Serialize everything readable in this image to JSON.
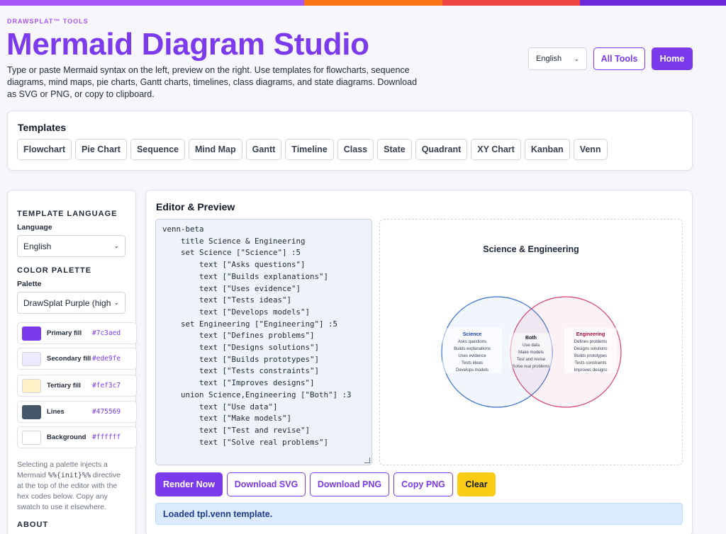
{
  "colors": {
    "topbar": [
      "#a855f7",
      "#f97316",
      "#ef4444",
      "#6d28d9"
    ],
    "primary": "#7c3aed",
    "clear_button": "#facc15"
  },
  "header": {
    "brand": "DRAWSPLAT™ TOOLS",
    "title": "Mermaid Diagram Studio",
    "description": "Type or paste Mermaid syntax on the left, preview on the right. Use templates for flowcharts, sequence diagrams, mind maps, pie charts, Gantt charts, timelines, class diagrams, and state diagrams. Download as SVG or PNG, or copy to clipboard.",
    "language_selected": "English",
    "all_tools_label": "All Tools",
    "home_label": "Home"
  },
  "templates": {
    "title": "Templates",
    "items": [
      "Flowchart",
      "Pie Chart",
      "Sequence",
      "Mind Map",
      "Gantt",
      "Timeline",
      "Class",
      "State",
      "Quadrant",
      "XY Chart",
      "Kanban",
      "Venn"
    ]
  },
  "sidebar": {
    "template_language_heading": "TEMPLATE LANGUAGE",
    "language_label": "Language",
    "language_value": "English",
    "color_palette_heading": "COLOR PALETTE",
    "palette_label": "Palette",
    "palette_value": "DrawSplat Purple (high c",
    "swatches": [
      {
        "name": "Primary fill",
        "hex": "#7c3aed"
      },
      {
        "name": "Secondary fill",
        "hex": "#ede9fe"
      },
      {
        "name": "Tertiary fill",
        "hex": "#fef3c7"
      },
      {
        "name": "Lines",
        "hex": "#475569"
      },
      {
        "name": "Background",
        "hex": "#ffffff"
      }
    ],
    "note_pre": "Selecting a palette injects a Mermaid",
    "note_code": "%%{init}%%",
    "note_post": "directive at the top of the editor with the hex codes below. Copy any swatch to use it elsewhere.",
    "about_heading": "ABOUT"
  },
  "editor": {
    "title": "Editor & Preview",
    "lines": [
      "venn-beta",
      "    title Science & Engineering",
      "    set Science [\"Science\"] :5",
      "        text [\"Asks questions\"]",
      "        text [\"Builds explanations\"]",
      "        text [\"Uses evidence\"]",
      "        text [\"Tests ideas\"]",
      "        text [\"Develops models\"]",
      "    set Engineering [\"Engineering\"] :5",
      "        text [\"Defines problems\"]",
      "        text [\"Designs solutions\"]",
      "        text [\"Builds prototypes\"]",
      "        text [\"Tests constraints\"]",
      "        text [\"Improves designs\"]",
      "    union Science,Engineering [\"Both\"] :3",
      "        text [\"Use data\"]",
      "        text [\"Make models\"]",
      "        text [\"Test and revise\"]",
      "        text [\"Solve real problems\"]"
    ]
  },
  "preview": {
    "title": "Science & Engineering",
    "science": {
      "label": "Science",
      "items": [
        "Asks questions",
        "Builds explanations",
        "Uses evidence",
        "Tests ideas",
        "Develops models"
      ],
      "color": "#3b6fd1"
    },
    "both": {
      "label": "Both",
      "items": [
        "Use data",
        "Make models",
        "Test and revise",
        "Solve real problems"
      ]
    },
    "engineering": {
      "label": "Engineering",
      "items": [
        "Defines problems",
        "Designs solutions",
        "Builds prototypes",
        "Tests constraints",
        "Improves designs"
      ],
      "color": "#d9406f"
    }
  },
  "actions": {
    "render": "Render Now",
    "download_svg": "Download SVG",
    "download_png": "Download PNG",
    "copy_png": "Copy PNG",
    "clear": "Clear"
  },
  "status": "Loaded tpl.venn template."
}
